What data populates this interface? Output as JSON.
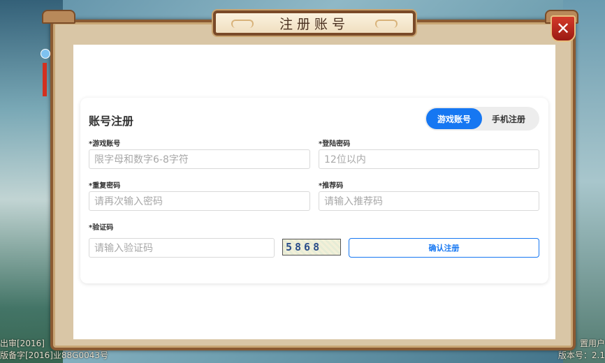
{
  "background": {
    "left_text_lines": [
      "出审[2016]",
      "版备字[2016]业88G0043号"
    ],
    "right_text_lines": [
      "置用户",
      "版本号：2.1"
    ]
  },
  "dialog": {
    "title": "注册账号",
    "close_symbol": "✕"
  },
  "form": {
    "heading": "账号注册",
    "tabs": [
      {
        "label": "游戏账号",
        "active": true
      },
      {
        "label": "手机注册",
        "active": false
      }
    ],
    "fields": {
      "game_account": {
        "label": "*游戏账号",
        "placeholder": "限字母和数字6-8字符",
        "value": ""
      },
      "password": {
        "label": "*登陆密码",
        "placeholder": "12位以内",
        "value": ""
      },
      "confirm_password": {
        "label": "*重复密码",
        "placeholder": "请再次输入密码",
        "value": ""
      },
      "referral_code": {
        "label": "*推荐码",
        "placeholder": "请输入推荐码",
        "value": ""
      },
      "captcha": {
        "label": "*验证码",
        "placeholder": "请输入验证码",
        "value": ""
      }
    },
    "captcha_image_text": "5868",
    "submit_label": "确认注册"
  },
  "colors": {
    "accent": "#1677f2",
    "frame_border": "#8a5a32",
    "close_button": "#c0281c"
  }
}
